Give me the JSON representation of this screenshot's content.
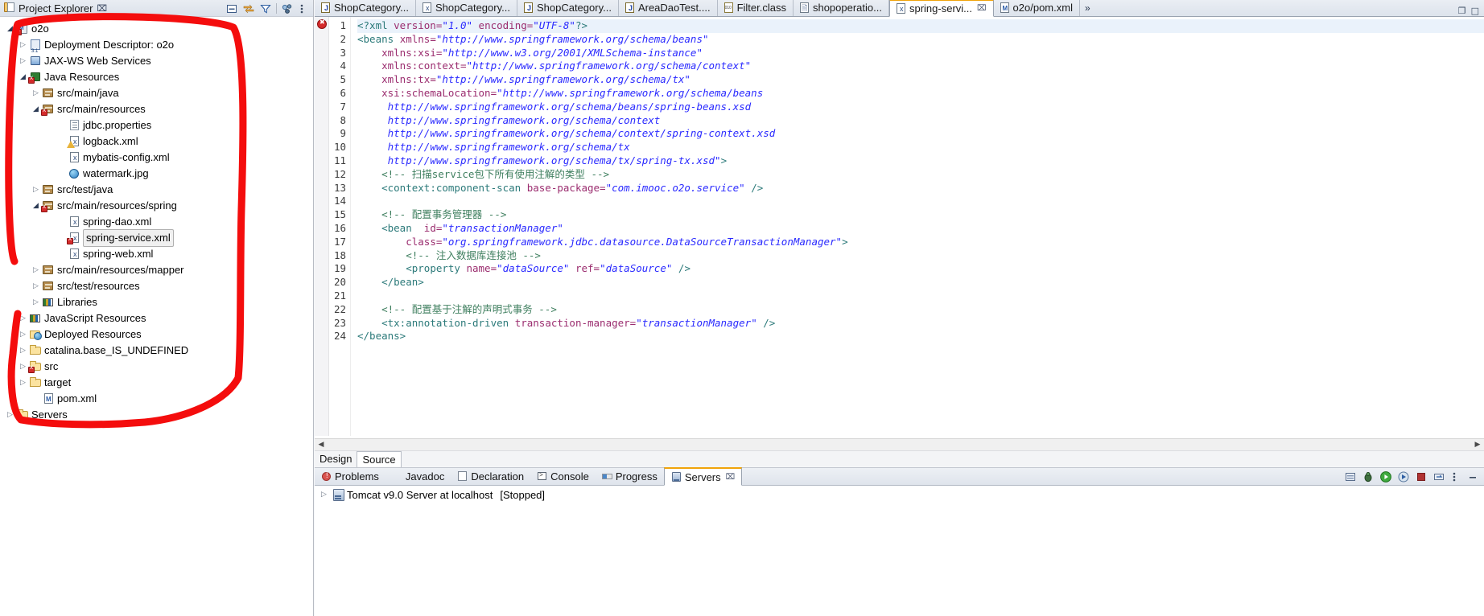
{
  "explorer": {
    "title": "Project Explorer",
    "close_glyph": "⌧",
    "toolbar": [
      {
        "name": "collapse-all-icon",
        "glyph": "⊟"
      },
      {
        "name": "link-with-editor-icon",
        "glyph": "⇆"
      },
      {
        "name": "filter-icon",
        "glyph": "▽"
      },
      {
        "name": "view-menu-icon",
        "glyph": "▾"
      },
      {
        "name": "minimize-icon",
        "glyph": "─"
      }
    ],
    "tree": [
      {
        "label": "o2o",
        "indent": 0,
        "arrow": "open",
        "icon": "maven-project-error-icon"
      },
      {
        "label": "Deployment Descriptor: o2o",
        "indent": 1,
        "arrow": "closed",
        "icon": "deployment-descriptor-icon"
      },
      {
        "label": "JAX-WS Web Services",
        "indent": 1,
        "arrow": "closed",
        "icon": "jaxws-icon"
      },
      {
        "label": "Java Resources",
        "indent": 1,
        "arrow": "open",
        "icon": "java-resources-error-icon"
      },
      {
        "label": "src/main/java",
        "indent": 2,
        "arrow": "closed",
        "icon": "source-folder-icon"
      },
      {
        "label": "src/main/resources",
        "indent": 2,
        "arrow": "open",
        "icon": "source-folder-error-icon"
      },
      {
        "label": "jdbc.properties",
        "indent": 4,
        "arrow": "none",
        "icon": "properties-file-icon"
      },
      {
        "label": "logback.xml",
        "indent": 4,
        "arrow": "none",
        "icon": "xml-file-warning-icon"
      },
      {
        "label": "mybatis-config.xml",
        "indent": 4,
        "arrow": "none",
        "icon": "xml-file-icon"
      },
      {
        "label": "watermark.jpg",
        "indent": 4,
        "arrow": "none",
        "icon": "image-file-icon"
      },
      {
        "label": "src/test/java",
        "indent": 2,
        "arrow": "closed",
        "icon": "source-folder-icon"
      },
      {
        "label": "src/main/resources/spring",
        "indent": 2,
        "arrow": "open",
        "icon": "source-folder-error-icon"
      },
      {
        "label": "spring-dao.xml",
        "indent": 4,
        "arrow": "none",
        "icon": "xml-file-icon"
      },
      {
        "label": "spring-service.xml",
        "indent": 4,
        "arrow": "none",
        "icon": "xml-file-error-icon",
        "selected": true
      },
      {
        "label": "spring-web.xml",
        "indent": 4,
        "arrow": "none",
        "icon": "xml-file-icon"
      },
      {
        "label": "src/main/resources/mapper",
        "indent": 2,
        "arrow": "closed",
        "icon": "source-folder-icon"
      },
      {
        "label": "src/test/resources",
        "indent": 2,
        "arrow": "closed",
        "icon": "source-folder-icon"
      },
      {
        "label": "Libraries",
        "indent": 2,
        "arrow": "closed",
        "icon": "libraries-icon"
      },
      {
        "label": "JavaScript Resources",
        "indent": 1,
        "arrow": "closed",
        "icon": "libraries-icon"
      },
      {
        "label": "Deployed Resources",
        "indent": 1,
        "arrow": "closed",
        "icon": "deployed-resources-icon"
      },
      {
        "label": "catalina.base_IS_UNDEFINED",
        "indent": 1,
        "arrow": "closed",
        "icon": "folder-icon"
      },
      {
        "label": "src",
        "indent": 1,
        "arrow": "closed",
        "icon": "folder-error-icon"
      },
      {
        "label": "target",
        "indent": 1,
        "arrow": "closed",
        "icon": "folder-icon"
      },
      {
        "label": "pom.xml",
        "indent": 2,
        "arrow": "none",
        "icon": "maven-pom-icon"
      },
      {
        "label": "Servers",
        "indent": 0,
        "arrow": "closed",
        "icon": "folder-icon"
      }
    ],
    "annotation_color": "#f40d0d"
  },
  "editor": {
    "tabs": [
      {
        "label": "ShopCategory...",
        "icon": "java-file-icon",
        "active": false
      },
      {
        "label": "ShopCategory...",
        "icon": "xml-file-icon",
        "active": false
      },
      {
        "label": "ShopCategory...",
        "icon": "java-file-icon",
        "active": false
      },
      {
        "label": "AreaDaoTest....",
        "icon": "java-file-icon",
        "active": false
      },
      {
        "label": "Filter.class",
        "icon": "class-file-icon",
        "active": false
      },
      {
        "label": "shopoperatio...",
        "icon": "jsp-file-icon",
        "active": false
      },
      {
        "label": "spring-servi...",
        "icon": "xml-file-icon",
        "active": true,
        "close_glyph": "⌧"
      },
      {
        "label": "o2o/pom.xml",
        "icon": "maven-pom-icon",
        "active": false
      }
    ],
    "overflow_label": "»",
    "window_buttons": [
      {
        "name": "restore-icon",
        "glyph": "❐"
      },
      {
        "name": "maximize-icon",
        "glyph": "□"
      }
    ],
    "line_count": 24,
    "lines": [
      {
        "n": 1,
        "highlight": true,
        "tokens": [
          {
            "t": "<?xml ",
            "c": "pi"
          },
          {
            "t": "version=",
            "c": "at"
          },
          {
            "t": "\"1.0\"",
            "c": "st"
          },
          {
            "t": " ",
            "c": "pl"
          },
          {
            "t": "encoding=",
            "c": "at"
          },
          {
            "t": "\"UTF-8\"",
            "c": "st"
          },
          {
            "t": "?>",
            "c": "pi"
          }
        ]
      },
      {
        "n": 2,
        "tokens": [
          {
            "t": "<beans ",
            "c": "tg"
          },
          {
            "t": "xmlns=",
            "c": "at"
          },
          {
            "t": "\"http://www.springframework.org/schema/beans\"",
            "c": "st"
          }
        ]
      },
      {
        "n": 3,
        "tokens": [
          {
            "t": "    ",
            "c": "pl"
          },
          {
            "t": "xmlns:xsi=",
            "c": "at"
          },
          {
            "t": "\"http://www.w3.org/2001/XMLSchema-instance\"",
            "c": "st"
          }
        ]
      },
      {
        "n": 4,
        "tokens": [
          {
            "t": "    ",
            "c": "pl"
          },
          {
            "t": "xmlns:context=",
            "c": "at"
          },
          {
            "t": "\"http://www.springframework.org/schema/context\"",
            "c": "st"
          }
        ]
      },
      {
        "n": 5,
        "tokens": [
          {
            "t": "    ",
            "c": "pl"
          },
          {
            "t": "xmlns:tx=",
            "c": "at"
          },
          {
            "t": "\"http://www.springframework.org/schema/tx\"",
            "c": "st"
          }
        ]
      },
      {
        "n": 6,
        "tokens": [
          {
            "t": "    ",
            "c": "pl"
          },
          {
            "t": "xsi:schemaLocation=",
            "c": "at"
          },
          {
            "t": "\"http://www.springframework.org/schema/beans",
            "c": "st"
          }
        ]
      },
      {
        "n": 7,
        "tokens": [
          {
            "t": "     ",
            "c": "pl"
          },
          {
            "t": "http://www.springframework.org/schema/beans/spring-beans.xsd",
            "c": "st"
          }
        ]
      },
      {
        "n": 8,
        "tokens": [
          {
            "t": "     ",
            "c": "pl"
          },
          {
            "t": "http://www.springframework.org/schema/context",
            "c": "st"
          }
        ]
      },
      {
        "n": 9,
        "tokens": [
          {
            "t": "     ",
            "c": "pl"
          },
          {
            "t": "http://www.springframework.org/schema/context/spring-context.xsd",
            "c": "st"
          }
        ]
      },
      {
        "n": 10,
        "tokens": [
          {
            "t": "     ",
            "c": "pl"
          },
          {
            "t": "http://www.springframework.org/schema/tx",
            "c": "st"
          }
        ]
      },
      {
        "n": 11,
        "tokens": [
          {
            "t": "     ",
            "c": "pl"
          },
          {
            "t": "http://www.springframework.org/schema/tx/spring-tx.xsd\"",
            "c": "st"
          },
          {
            "t": ">",
            "c": "tg"
          }
        ]
      },
      {
        "n": 12,
        "tokens": [
          {
            "t": "    ",
            "c": "pl"
          },
          {
            "t": "<!-- 扫描service包下所有使用注解的类型 -->",
            "c": "cm"
          }
        ]
      },
      {
        "n": 13,
        "tokens": [
          {
            "t": "    ",
            "c": "pl"
          },
          {
            "t": "<context:component-scan ",
            "c": "tg"
          },
          {
            "t": "base-package=",
            "c": "at"
          },
          {
            "t": "\"com.imooc.o2o.service\"",
            "c": "st"
          },
          {
            "t": " />",
            "c": "tg"
          }
        ]
      },
      {
        "n": 14,
        "tokens": [
          {
            "t": "",
            "c": "pl"
          }
        ]
      },
      {
        "n": 15,
        "tokens": [
          {
            "t": "    ",
            "c": "pl"
          },
          {
            "t": "<!-- 配置事务管理器 -->",
            "c": "cm"
          }
        ]
      },
      {
        "n": 16,
        "tokens": [
          {
            "t": "    ",
            "c": "pl"
          },
          {
            "t": "<bean ",
            "c": "tg"
          },
          {
            "t": " id=",
            "c": "at"
          },
          {
            "t": "\"transactionManager\"",
            "c": "st"
          }
        ]
      },
      {
        "n": 17,
        "tokens": [
          {
            "t": "        ",
            "c": "pl"
          },
          {
            "t": "class=",
            "c": "at"
          },
          {
            "t": "\"org.springframework.jdbc.datasource.DataSourceTransactionManager\"",
            "c": "st"
          },
          {
            "t": ">",
            "c": "tg"
          }
        ]
      },
      {
        "n": 18,
        "tokens": [
          {
            "t": "        ",
            "c": "pl"
          },
          {
            "t": "<!-- 注入数据库连接池 -->",
            "c": "cm"
          }
        ]
      },
      {
        "n": 19,
        "tokens": [
          {
            "t": "        ",
            "c": "pl"
          },
          {
            "t": "<property ",
            "c": "tg"
          },
          {
            "t": "name=",
            "c": "at"
          },
          {
            "t": "\"dataSource\"",
            "c": "st"
          },
          {
            "t": " ",
            "c": "pl"
          },
          {
            "t": "ref=",
            "c": "at"
          },
          {
            "t": "\"dataSource\"",
            "c": "st"
          },
          {
            "t": " />",
            "c": "tg"
          }
        ]
      },
      {
        "n": 20,
        "tokens": [
          {
            "t": "    ",
            "c": "pl"
          },
          {
            "t": "</bean>",
            "c": "tg"
          }
        ]
      },
      {
        "n": 21,
        "tokens": [
          {
            "t": "",
            "c": "pl"
          }
        ]
      },
      {
        "n": 22,
        "tokens": [
          {
            "t": "    ",
            "c": "pl"
          },
          {
            "t": "<!-- 配置基于注解的声明式事务 -->",
            "c": "cm"
          }
        ]
      },
      {
        "n": 23,
        "tokens": [
          {
            "t": "    ",
            "c": "pl"
          },
          {
            "t": "<tx:annotation-driven ",
            "c": "tg"
          },
          {
            "t": "transaction-manager=",
            "c": "at"
          },
          {
            "t": "\"transactionManager\"",
            "c": "st"
          },
          {
            "t": " />",
            "c": "tg"
          }
        ]
      },
      {
        "n": 24,
        "tokens": [
          {
            "t": "</beans>",
            "c": "tg"
          }
        ]
      }
    ],
    "page_tabs": [
      {
        "label": "Design",
        "active": false
      },
      {
        "label": "Source",
        "active": true
      }
    ],
    "scroll_left_glyph": "◀",
    "scroll_right_glyph": "▶"
  },
  "bottom_panel": {
    "tabs": [
      {
        "label": "Problems",
        "icon": "problems-icon",
        "active": false
      },
      {
        "label": "Javadoc",
        "icon": "javadoc-icon",
        "active": false
      },
      {
        "label": "Declaration",
        "icon": "declaration-icon",
        "active": false
      },
      {
        "label": "Console",
        "icon": "console-icon",
        "active": false
      },
      {
        "label": "Progress",
        "icon": "progress-icon",
        "active": false
      },
      {
        "label": "Servers",
        "icon": "servers-icon",
        "active": true,
        "close_glyph": "⌧"
      }
    ],
    "toolbar": [
      {
        "name": "new-server-icon",
        "glyph": "▤"
      },
      {
        "name": "debug-icon",
        "glyph": "✇"
      },
      {
        "name": "start-icon",
        "glyph": "▶"
      },
      {
        "name": "profile-icon",
        "glyph": "➤"
      },
      {
        "name": "stop-icon",
        "glyph": "■"
      },
      {
        "name": "publish-icon",
        "glyph": "↻"
      },
      {
        "name": "view-menu-icon",
        "glyph": "⋮"
      },
      {
        "name": "minimize-icon",
        "glyph": "─"
      }
    ],
    "servers": [
      {
        "name": "Tomcat v9.0 Server at localhost",
        "status": "[Stopped]",
        "arrow": "closed"
      }
    ]
  }
}
